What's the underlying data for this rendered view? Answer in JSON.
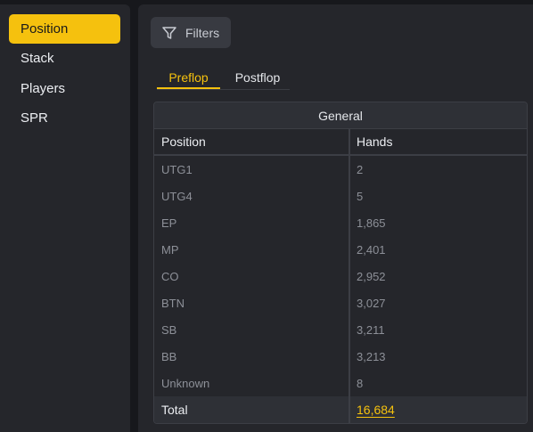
{
  "sidebar": {
    "items": [
      {
        "label": "Position",
        "active": true
      },
      {
        "label": "Stack",
        "active": false
      },
      {
        "label": "Players",
        "active": false
      },
      {
        "label": "SPR",
        "active": false
      }
    ]
  },
  "toolbar": {
    "filters_label": "Filters",
    "filters_icon": "filter-icon"
  },
  "tabs": [
    {
      "label": "Preflop",
      "active": true
    },
    {
      "label": "Postflop",
      "active": false
    }
  ],
  "table": {
    "title": "General",
    "columns": [
      "Position",
      "Hands"
    ],
    "rows": [
      {
        "position": "UTG1",
        "hands": "2"
      },
      {
        "position": "UTG4",
        "hands": "5"
      },
      {
        "position": "EP",
        "hands": "1,865"
      },
      {
        "position": "MP",
        "hands": "2,401"
      },
      {
        "position": "CO",
        "hands": "2,952"
      },
      {
        "position": "BTN",
        "hands": "3,027"
      },
      {
        "position": "SB",
        "hands": "3,211"
      },
      {
        "position": "BB",
        "hands": "3,213"
      },
      {
        "position": "Unknown",
        "hands": "8"
      }
    ],
    "total": {
      "label": "Total",
      "value": "16,684"
    }
  },
  "colors": {
    "accent": "#f5c10e",
    "panel": "#25262b",
    "background": "#17181c"
  }
}
